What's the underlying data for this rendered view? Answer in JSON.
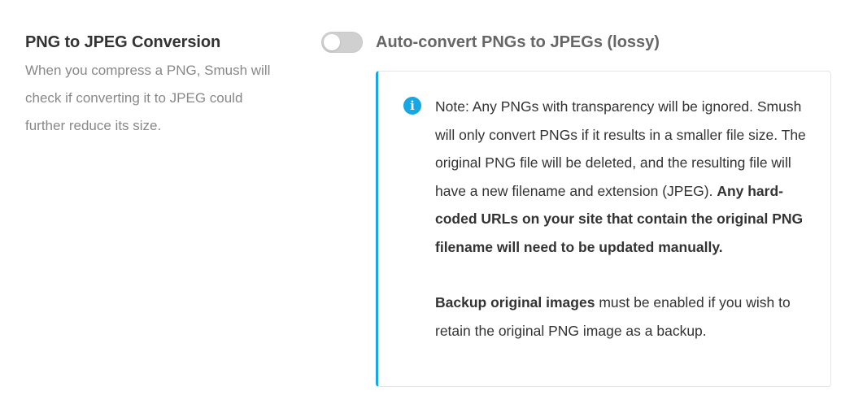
{
  "setting": {
    "title": "PNG to JPEG Conversion",
    "description": "When you compress a PNG, Smush will check if converting it to JPEG could further reduce its size."
  },
  "toggle": {
    "label": "Auto-convert PNGs to JPEGs (lossy)",
    "enabled": false
  },
  "notice": {
    "icon": "info-icon",
    "color": "#17a8e3",
    "paragraph1_text": "Note: Any PNGs with transparency will be ignored. Smush will only convert PNGs if it results in a smaller file size. The original PNG file will be deleted, and the resulting file will have a new filename and extension (JPEG). ",
    "paragraph1_bold": "Any hard-coded URLs on your site that contain the original PNG filename will need to be updated manually.",
    "paragraph2_bold": "Backup original images",
    "paragraph2_text": " must be enabled if you wish to retain the original PNG image as a backup."
  }
}
